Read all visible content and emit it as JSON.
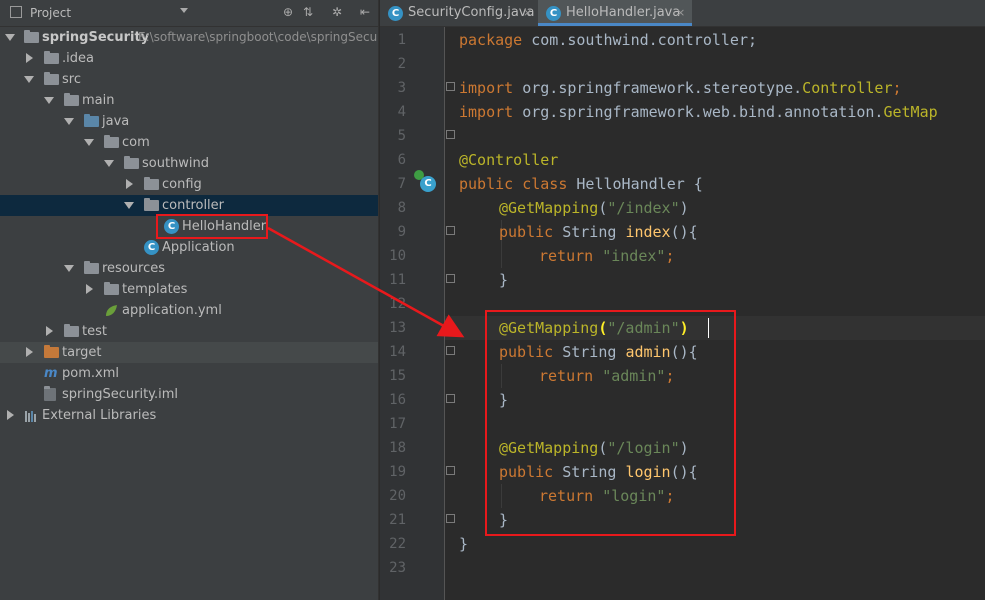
{
  "project_panel": {
    "title": "Project",
    "toolbar": {
      "target_icon": "crosshair-icon",
      "collapse_icon": "collapse-all-icon",
      "settings_icon": "gear-icon",
      "hide_icon": "hide-panel-icon"
    }
  },
  "tree": [
    {
      "label": "springSecurity",
      "path": "E:\\software\\springboot\\code\\springSecur",
      "icon": "module-folder-icon"
    },
    {
      "label": ".idea",
      "icon": "folder-icon"
    },
    {
      "label": "src",
      "icon": "folder-icon"
    },
    {
      "label": "main",
      "icon": "folder-icon"
    },
    {
      "label": "java",
      "icon": "source-folder-icon"
    },
    {
      "label": "com",
      "icon": "package-icon"
    },
    {
      "label": "southwind",
      "icon": "package-icon"
    },
    {
      "label": "config",
      "icon": "package-icon"
    },
    {
      "label": "controller",
      "icon": "package-icon"
    },
    {
      "label": "HelloHandler",
      "icon": "java-class-icon"
    },
    {
      "label": "Application",
      "icon": "spring-boot-class-icon"
    },
    {
      "label": "resources",
      "icon": "resources-folder-icon"
    },
    {
      "label": "templates",
      "icon": "folder-icon"
    },
    {
      "label": "application.yml",
      "icon": "spring-config-file-icon"
    },
    {
      "label": "test",
      "icon": "folder-icon"
    },
    {
      "label": "target",
      "icon": "excluded-folder-icon"
    },
    {
      "label": "pom.xml",
      "icon": "maven-file-icon"
    },
    {
      "label": "springSecurity.iml",
      "icon": "iml-file-icon"
    },
    {
      "label": "External Libraries",
      "icon": "libraries-icon"
    }
  ],
  "tabs": [
    {
      "label": "SecurityConfig.java",
      "close": "×"
    },
    {
      "label": "HelloHandler.java",
      "close": "×"
    }
  ],
  "code_lines": [
    "1",
    "2",
    "3",
    "4",
    "5",
    "6",
    "7",
    "8",
    "9",
    "10",
    "11",
    "12",
    "13",
    "14",
    "15",
    "16",
    "17",
    "18",
    "19",
    "20",
    "21",
    "22",
    "23"
  ],
  "code": {
    "l1": {
      "kw": "package",
      "rest": " com.southwind.controller;"
    },
    "l3": {
      "kw": "import",
      "rest": " org.springframework.stereotype.",
      "cls": "Controller",
      "end": ";"
    },
    "l4": {
      "kw": "import",
      "rest": " org.springframework.web.bind.annotation.",
      "cls": "GetMap"
    },
    "l6": {
      "an": "@Controller"
    },
    "l7": {
      "kw": "public class",
      "rest": " HelloHandler {"
    },
    "l8": {
      "an": "@GetMapping",
      "open": "(",
      "str": "\"/index\"",
      "close": ")"
    },
    "l9": {
      "kw": "public",
      "rest": " String ",
      "fn": "index",
      "end": "(){"
    },
    "l10": {
      "kw": "return",
      "str": " \"index\"",
      "end": ";"
    },
    "l11": {
      "text": "}"
    },
    "l13": {
      "an": "@GetMapping",
      "open": "(",
      "str": "\"/admin\"",
      "close": ")"
    },
    "l14": {
      "kw": "public",
      "rest": " String ",
      "fn": "admin",
      "end": "(){"
    },
    "l15": {
      "kw": "return",
      "str": " \"admin\"",
      "end": ";"
    },
    "l16": {
      "text": "}"
    },
    "l18": {
      "an": "@GetMapping",
      "open": "(",
      "str": "\"/login\"",
      "close": ")"
    },
    "l19": {
      "kw": "public",
      "rest": " String ",
      "fn": "login",
      "end": "(){"
    },
    "l20": {
      "kw": "return",
      "str": " \"login\"",
      "end": ";"
    },
    "l21": {
      "text": "}"
    },
    "l22": {
      "text": "}"
    }
  },
  "colors": {
    "highlight_red": "#e8191c",
    "keyword": "#cc7832",
    "annotation": "#bbb529",
    "string": "#6a8759",
    "method": "#ffc66d"
  }
}
